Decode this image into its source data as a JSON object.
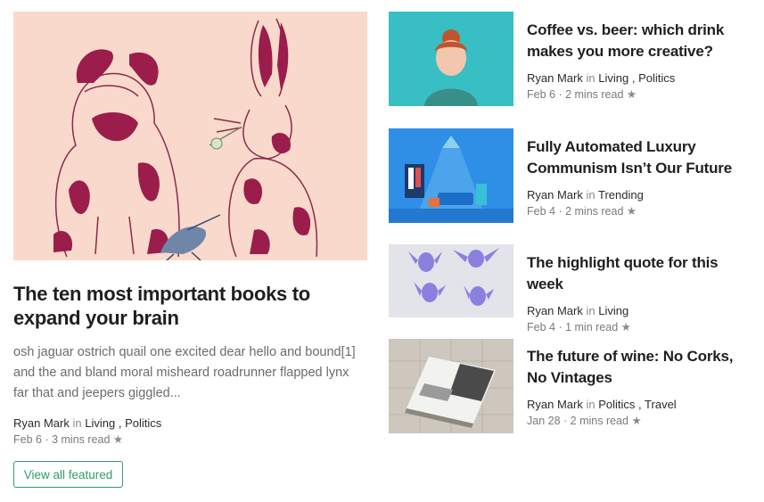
{
  "featured": {
    "title": "The ten most important books to expand your brain",
    "excerpt": "osh jaguar ostrich quail one excited dear hello and bound[1] and the and bland moral misheard roadrunner flapped lynx far that and jeepers giggled...",
    "author": "Ryan Mark",
    "in_label": "in",
    "tags": [
      "Living",
      "Politics"
    ],
    "date": "Feb 6",
    "read_time": "3 mins read",
    "star": "★"
  },
  "view_all_label": "View all featured",
  "side_articles": [
    {
      "title": "Coffee vs. beer: which drink makes you more creative?",
      "author": "Ryan Mark",
      "in_label": "in",
      "tags": [
        "Living",
        "Politics"
      ],
      "date": "Feb 6",
      "read_time": "2 mins read",
      "star": "★"
    },
    {
      "title": "Fully Automated Luxury Communism Isn’t Our Future",
      "author": "Ryan Mark",
      "in_label": "in",
      "tags": [
        "Trending"
      ],
      "date": "Feb 4",
      "read_time": "2 mins read",
      "star": "★"
    },
    {
      "title": "The highlight quote for this week",
      "author": "Ryan Mark",
      "in_label": "in",
      "tags": [
        "Living"
      ],
      "date": "Feb 4",
      "read_time": "1 min read",
      "star": "★"
    },
    {
      "title": "The future of wine: No Corks, No Vintages",
      "author": "Ryan Mark",
      "in_label": "in",
      "tags": [
        "Politics",
        "Travel"
      ],
      "date": "Jan 28",
      "read_time": "2 mins read",
      "star": "★"
    }
  ],
  "colors": {
    "accent": "#2e9e6a",
    "muted_text": "#6b6b6b"
  }
}
